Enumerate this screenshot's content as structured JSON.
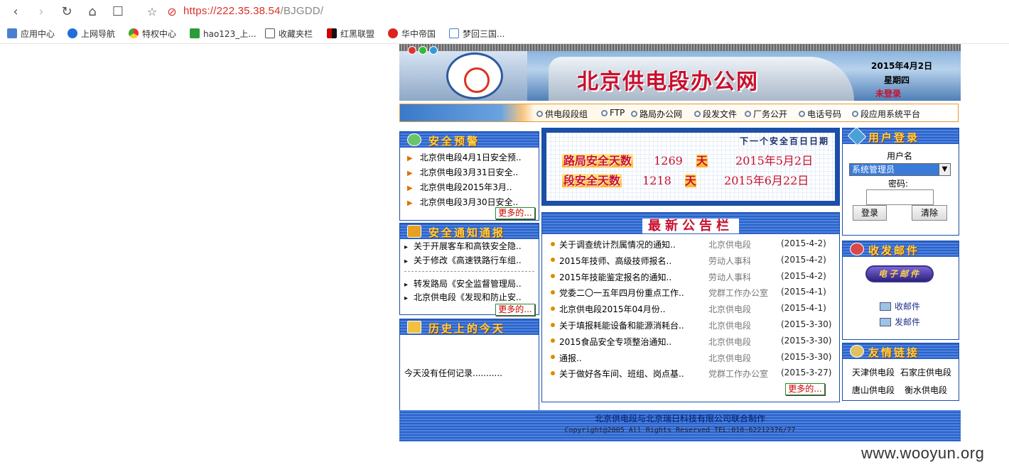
{
  "browser": {
    "url_host": "https://222.35.38.54",
    "url_path": "/BJGDD/",
    "bookmarks": [
      "应用中心",
      "上网导航",
      "特权中心",
      "hao123_上...",
      "收藏夹栏",
      "红黑联盟",
      "华中帝国",
      "梦回三国..."
    ]
  },
  "header": {
    "site_title": "北京供电段办公网",
    "date": "2015年4月2日",
    "weekday": "星期四",
    "login_state": "未登录"
  },
  "nav": [
    "供电段段组",
    "FTP",
    "路局办公网",
    "段发文件",
    "厂务公开",
    "电话号码",
    "段应用系统平台"
  ],
  "safety_warning": {
    "title": "安全预警",
    "items": [
      "北京供电段4月1日安全预..",
      "北京供电段3月31日安全..",
      "北京供电段2015年3月..",
      "北京供电段3月30日安全.."
    ],
    "more": "更多的..."
  },
  "safety_notice": {
    "title": "安全通知通报",
    "items": [
      "关于开展客车和高铁安全隐..",
      "关于修改《高速铁路行车组..",
      "转发路局《安全监督管理局..",
      "北京供电段《发现和防止安.."
    ],
    "more": "更多的..."
  },
  "history": {
    "title": "历史上的今天",
    "text": "今天没有任何记录..........."
  },
  "safety_days": {
    "next_label": "下一个安全百日日期",
    "rows": [
      {
        "label": "路局安全天数",
        "days": "1269",
        "unit": "天",
        "date": "2015年5月2日"
      },
      {
        "label": "段安全天数",
        "days": "1218",
        "unit": "天",
        "date": "2015年6月22日"
      }
    ]
  },
  "notices": {
    "title": "最新公告栏",
    "rows": [
      {
        "title": "关于调查统计烈属情况的通知..",
        "dept": "北京供电段",
        "date": "(2015-4-2)"
      },
      {
        "title": "2015年技师、高级技师报名..",
        "dept": "劳动人事科",
        "date": "(2015-4-2)"
      },
      {
        "title": "2015年技能鉴定报名的通知..",
        "dept": "劳动人事科",
        "date": "(2015-4-2)"
      },
      {
        "title": "党委二〇一五年四月份重点工作..",
        "dept": "党群工作办公室",
        "date": "(2015-4-1)"
      },
      {
        "title": "北京供电段2015年04月份..",
        "dept": "北京供电段",
        "date": "(2015-4-1)"
      },
      {
        "title": "关于填报耗能设备和能源消耗台..",
        "dept": "北京供电段",
        "date": "(2015-3-30)"
      },
      {
        "title": "2015食品安全专项整治通知..",
        "dept": "北京供电段",
        "date": "(2015-3-30)"
      },
      {
        "title": "通报..",
        "dept": "北京供电段",
        "date": "(2015-3-30)"
      },
      {
        "title": "关于做好各车间、班组、岗点基..",
        "dept": "党群工作办公室",
        "date": "(2015-3-27)"
      }
    ],
    "more": "更多的..."
  },
  "login": {
    "title": "用户登录",
    "username_label": "用户名",
    "username_value": "系统管理员",
    "password_label": "密码:",
    "login_button": "登录",
    "clear_button": "清除"
  },
  "mail": {
    "title": "收发邮件",
    "email_button": "电子邮件",
    "receive": "收邮件",
    "send": "发邮件"
  },
  "links": {
    "title": "友情链接",
    "items": [
      "天津供电段",
      "石家庄供电段",
      "唐山供电段",
      "衡水供电段"
    ]
  },
  "footer": {
    "line1": "北京供电段与北京瑞日科技有限公司联合制作",
    "line2": "Copyright@2005 All Rights Reserved TEL:010-62212376/77"
  },
  "watermark": "www.wooyun.org",
  "colors": {
    "accent_blue": "#1b4fa8",
    "title_red": "#c8102e",
    "url_red": "#d93025"
  }
}
